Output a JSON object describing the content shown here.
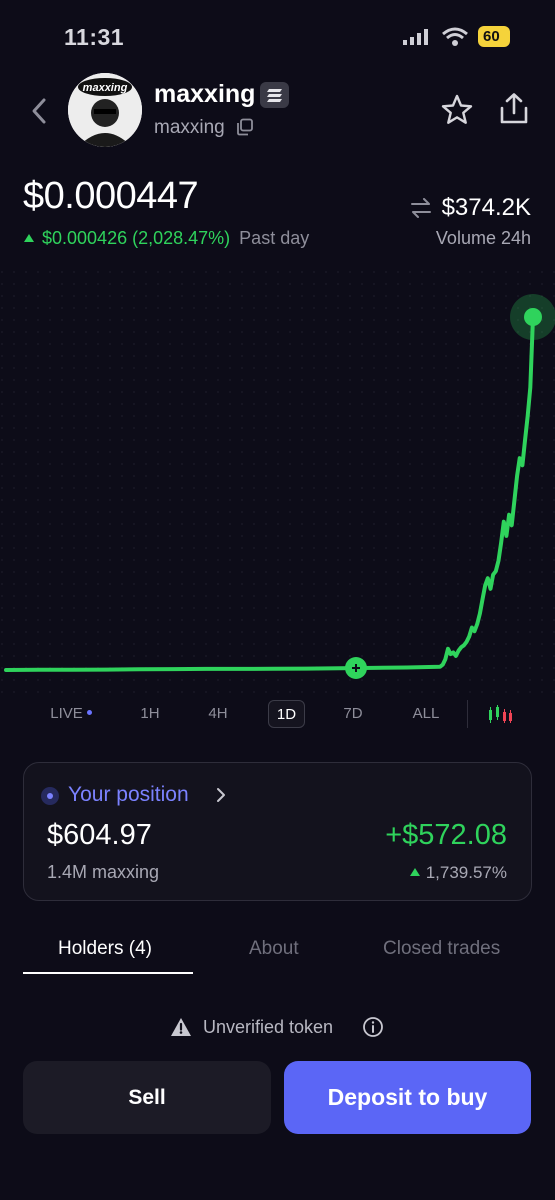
{
  "status_bar": {
    "time": "11:31",
    "battery": "60"
  },
  "token": {
    "name": "maxxing",
    "symbol": "maxxing",
    "avatar_text": "maxxing",
    "price": "$0.000447",
    "change": "$0.000426 (2,028.47%)",
    "change_period": "Past day",
    "volume": "$374.2K",
    "volume_label": "Volume 24h"
  },
  "chart": {
    "line_color": "#2fd35c",
    "series": [
      0,
      0.05,
      0.06,
      0.1,
      0.2,
      0.25,
      0.3,
      0.3,
      0.35,
      0.4,
      0.5,
      0.6,
      0.7,
      0.9,
      1.5,
      3,
      6,
      4.5,
      5,
      4,
      5.5,
      6.5,
      7,
      8,
      9.5,
      12,
      11,
      13,
      16,
      20,
      24,
      26,
      23,
      27,
      28,
      31,
      36,
      42,
      38,
      44,
      41,
      48,
      55,
      60,
      58,
      65,
      72,
      80,
      100
    ]
  },
  "timeframes": [
    {
      "label": "LIVE",
      "active": false
    },
    {
      "label": "1H",
      "active": false
    },
    {
      "label": "4H",
      "active": false
    },
    {
      "label": "1D",
      "active": true
    },
    {
      "label": "7D",
      "active": false
    },
    {
      "label": "ALL",
      "active": false
    }
  ],
  "position": {
    "title": "Your position",
    "value": "$604.97",
    "amount": "1.4M maxxing",
    "pnl": "+$572.08",
    "pnl_pct": "1,739.57%"
  },
  "tabs": [
    {
      "label": "Holders (4)",
      "active": true
    },
    {
      "label": "About",
      "active": false
    },
    {
      "label": "Closed trades",
      "active": false
    }
  ],
  "notice": {
    "text": "Unverified token"
  },
  "actions": {
    "sell": "Sell",
    "deposit": "Deposit to buy"
  },
  "colors": {
    "background": "#0d0c18",
    "positive": "#2fd35c",
    "accent": "#5b66f6"
  }
}
